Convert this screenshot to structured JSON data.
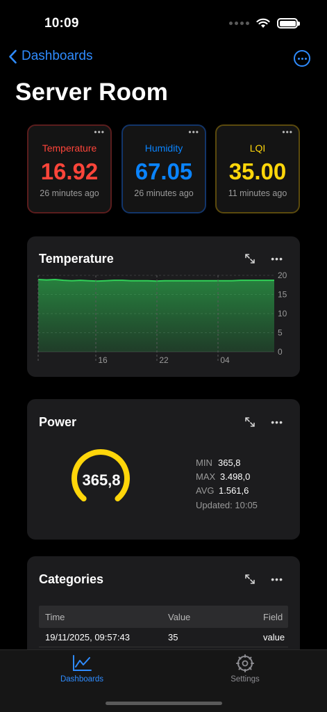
{
  "status_bar": {
    "time": "10:09"
  },
  "nav": {
    "back_label": "Dashboards"
  },
  "page": {
    "title": "Server Room"
  },
  "stat_cards": [
    {
      "label": "Temperature",
      "value": "16.92",
      "ago": "26 minutes ago",
      "menu": "•••",
      "color": "#ff453a"
    },
    {
      "label": "Humidity",
      "value": "67.05",
      "ago": "26 minutes ago",
      "menu": "•••",
      "color": "#0a84ff"
    },
    {
      "label": "LQI",
      "value": "35.00",
      "ago": "11 minutes ago",
      "menu": "•••",
      "color": "#ffd60a"
    }
  ],
  "temperature_panel": {
    "title": "Temperature",
    "menu": "•••"
  },
  "chart_data": {
    "type": "area",
    "title": "Temperature",
    "x_ticks": [
      "16",
      "22",
      "04"
    ],
    "y_ticks": [
      "20",
      "15",
      "10",
      "5",
      "0"
    ],
    "ylim": [
      0,
      20
    ],
    "series": [
      {
        "values": [
          18.9,
          18.8,
          18.9,
          18.7,
          18.6,
          18.7,
          18.6,
          18.5,
          18.6,
          18.7,
          18.7,
          18.6,
          18.6,
          18.6,
          18.5,
          18.6,
          18.6,
          18.6,
          18.6,
          18.6,
          18.6,
          18.6,
          18.6,
          18.6,
          18.7,
          18.7,
          18.7,
          18.7,
          18.7
        ]
      }
    ],
    "color": "#30d158",
    "grid": true
  },
  "power_panel": {
    "title": "Power",
    "menu": "•••",
    "gauge_value": "365,8",
    "gauge_fraction": 0.104,
    "gauge_color": "#ffd60a",
    "min_label": "MIN",
    "min_value": "365,8",
    "max_label": "MAX",
    "max_value": "3.498,0",
    "avg_label": "AVG",
    "avg_value": "1.561,6",
    "updated": "Updated: 10:05"
  },
  "categories_panel": {
    "title": "Categories",
    "menu": "•••",
    "columns": [
      "Time",
      "Value",
      "Field"
    ],
    "rows": [
      {
        "time": "19/11/2025, 09:57:43",
        "value": "35",
        "field": "value"
      }
    ]
  },
  "tabbar": {
    "dashboards": "Dashboards",
    "settings": "Settings"
  }
}
